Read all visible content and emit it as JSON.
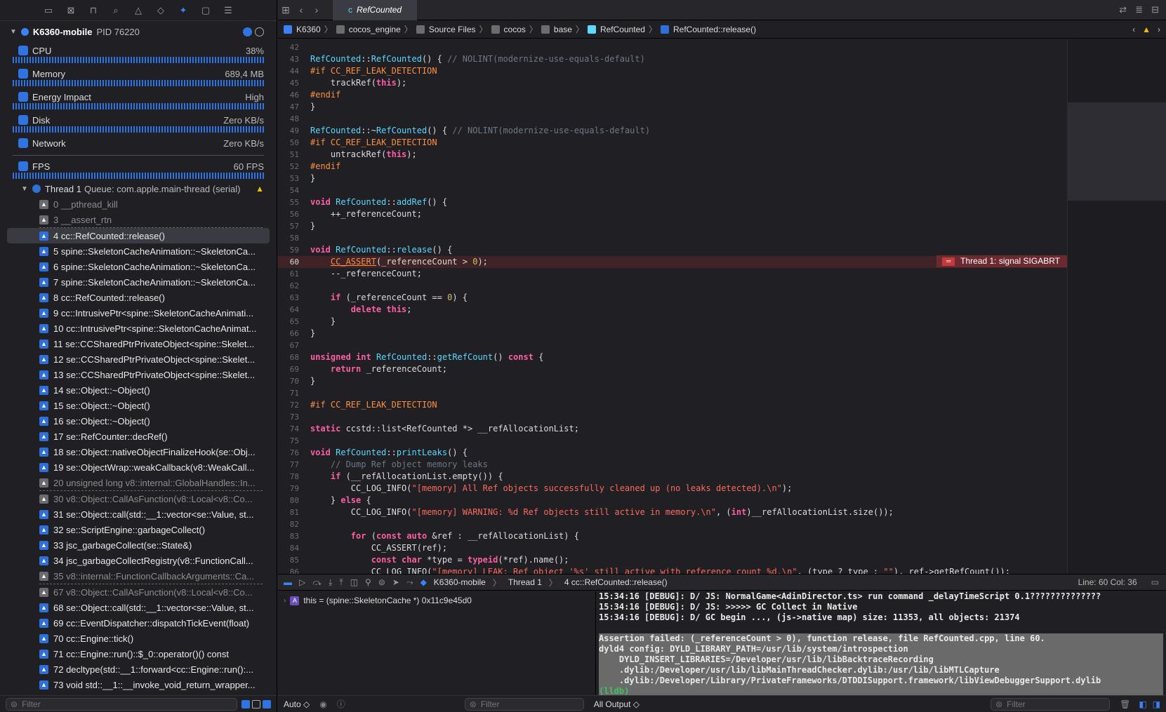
{
  "navigator": {
    "icons": [
      "folder-icon",
      "source-control-icon",
      "hierarchy-icon",
      "search-icon",
      "warning-icon",
      "breakpoint-diamond-icon",
      "debug-spray-icon",
      "tag-icon",
      "report-icon"
    ],
    "process": {
      "name": "K6360-mobile",
      "pid": "PID 76220"
    },
    "gauges": [
      {
        "label": "CPU",
        "value": "38%",
        "color": "#2f74e0",
        "icon": "cpu-icon"
      },
      {
        "label": "Memory",
        "value": "689,4 MB",
        "color": "#2f74e0",
        "icon": "memory-icon"
      },
      {
        "label": "Energy Impact",
        "value": "High",
        "color": "#2f74e0",
        "icon": "energy-icon"
      },
      {
        "label": "Disk",
        "value": "Zero KB/s",
        "color": "#2f74e0",
        "icon": "disk-icon"
      },
      {
        "label": "Network",
        "value": "Zero KB/s",
        "color": "#2f74e0",
        "icon": "network-icon"
      },
      {
        "label": "FPS",
        "value": "60 FPS",
        "color": "#2f74e0",
        "icon": "fps-icon"
      }
    ],
    "thread": {
      "name": "Thread 1",
      "queue": "Queue: com.apple.main-thread (serial)"
    },
    "frames": [
      {
        "text": "0 __pthread_kill",
        "dim": true
      },
      {
        "text": "3 __assert_rtn",
        "dim": true,
        "sepAfter": true
      },
      {
        "text": "4 cc::RefCounted::release()",
        "sel": true
      },
      {
        "text": "5 spine::SkeletonCacheAnimation::~SkeletonCa..."
      },
      {
        "text": "6 spine::SkeletonCacheAnimation::~SkeletonCa..."
      },
      {
        "text": "7 spine::SkeletonCacheAnimation::~SkeletonCa..."
      },
      {
        "text": "8 cc::RefCounted::release()"
      },
      {
        "text": "9 cc::IntrusivePtr<spine::SkeletonCacheAnimati..."
      },
      {
        "text": "10 cc::IntrusivePtr<spine::SkeletonCacheAnimat..."
      },
      {
        "text": "11 se::CCSharedPtrPrivateObject<spine::Skelet..."
      },
      {
        "text": "12 se::CCSharedPtrPrivateObject<spine::Skelet..."
      },
      {
        "text": "13 se::CCSharedPtrPrivateObject<spine::Skelet..."
      },
      {
        "text": "14 se::Object::~Object()"
      },
      {
        "text": "15 se::Object::~Object()"
      },
      {
        "text": "16 se::Object::~Object()"
      },
      {
        "text": "17 se::RefCounter::decRef()"
      },
      {
        "text": "18 se::Object::nativeObjectFinalizeHook(se::Obj..."
      },
      {
        "text": "19 se::ObjectWrap::weakCallback(v8::WeakCall..."
      },
      {
        "text": "20 unsigned long v8::internal::GlobalHandles::In...",
        "dim": true,
        "sepAfter": true
      },
      {
        "text": "30 v8::Object::CallAsFunction(v8::Local<v8::Co...",
        "dim": true
      },
      {
        "text": "31 se::Object::call(std::__1::vector<se::Value, st..."
      },
      {
        "text": "32 se::ScriptEngine::garbageCollect()"
      },
      {
        "text": "33 jsc_garbageCollect(se::State&)"
      },
      {
        "text": "34 jsc_garbageCollectRegistry(v8::FunctionCall..."
      },
      {
        "text": "35 v8::internal::FunctionCallbackArguments::Ca...",
        "dim": true,
        "sepAfter": true
      },
      {
        "text": "67 v8::Object::CallAsFunction(v8::Local<v8::Co...",
        "dim": true
      },
      {
        "text": "68 se::Object::call(std::__1::vector<se::Value, st..."
      },
      {
        "text": "69 cc::EventDispatcher::dispatchTickEvent(float)"
      },
      {
        "text": "70 cc::Engine::tick()"
      },
      {
        "text": "71 cc::Engine::run()::$_0::operator()() const"
      },
      {
        "text": "72 decltype(std::__1::forward<cc::Engine::run():..."
      },
      {
        "text": "73 void std::__1::__invoke_void_return_wrapper..."
      }
    ],
    "filter_placeholder": "Filter"
  },
  "editor": {
    "tab": "RefCounted",
    "breadcrumbs": [
      "K6360",
      "cocos_engine",
      "Source Files",
      "cocos",
      "base",
      "RefCounted",
      "RefCounted::release()"
    ],
    "error_label": "Thread 1: signal SIGABRT",
    "lines": [
      {
        "n": "42",
        "h": ""
      },
      {
        "n": "43",
        "h": "<span class='t'>RefCounted</span>::<span class='t'>RefCounted</span>() { <span class='c'>// NOLINT(modernize-use-equals-default)</span>"
      },
      {
        "n": "44",
        "h": "<span class='p'>#if CC_REF_LEAK_DETECTION</span>"
      },
      {
        "n": "45",
        "h": "    trackRef(<span class='k'>this</span>);"
      },
      {
        "n": "46",
        "h": "<span class='p'>#endif</span>"
      },
      {
        "n": "47",
        "h": "}"
      },
      {
        "n": "48",
        "h": ""
      },
      {
        "n": "49",
        "h": "<span class='t'>RefCounted</span>::~<span class='t'>RefCounted</span>() { <span class='c'>// NOLINT(modernize-use-equals-default)</span>"
      },
      {
        "n": "50",
        "h": "<span class='p'>#if CC_REF_LEAK_DETECTION</span>"
      },
      {
        "n": "51",
        "h": "    untrackRef(<span class='k'>this</span>);"
      },
      {
        "n": "52",
        "h": "<span class='p'>#endif</span>"
      },
      {
        "n": "53",
        "h": "}"
      },
      {
        "n": "54",
        "h": ""
      },
      {
        "n": "55",
        "h": "<span class='k'>void</span> <span class='t'>RefCounted</span>::<span class='t'>addRef</span>() {"
      },
      {
        "n": "56",
        "h": "    ++_referenceCount;"
      },
      {
        "n": "57",
        "h": "}"
      },
      {
        "n": "58",
        "h": ""
      },
      {
        "n": "59",
        "h": "<span class='k'>void</span> <span class='t'>RefCounted</span>::<span class='t'>release</span>() {"
      },
      {
        "n": "60",
        "h": "    <span class='p' style='text-decoration:underline'>CC_ASSERT</span>(_referenceCount > <span class='n'>0</span>);",
        "err": true
      },
      {
        "n": "61",
        "h": "    --_referenceCount;"
      },
      {
        "n": "62",
        "h": ""
      },
      {
        "n": "63",
        "h": "    <span class='k'>if</span> (_referenceCount == <span class='n'>0</span>) {"
      },
      {
        "n": "64",
        "h": "        <span class='k'>delete this</span>;"
      },
      {
        "n": "65",
        "h": "    }"
      },
      {
        "n": "66",
        "h": "}"
      },
      {
        "n": "67",
        "h": ""
      },
      {
        "n": "68",
        "h": "<span class='k'>unsigned int</span> <span class='t'>RefCounted</span>::<span class='t'>getRefCount</span>() <span class='k'>const</span> {"
      },
      {
        "n": "69",
        "h": "    <span class='k'>return</span> _referenceCount;"
      },
      {
        "n": "70",
        "h": "}"
      },
      {
        "n": "71",
        "h": ""
      },
      {
        "n": "72",
        "h": "<span class='p'>#if CC_REF_LEAK_DETECTION</span>"
      },
      {
        "n": "73",
        "h": ""
      },
      {
        "n": "74",
        "h": "<span class='k'>static</span> ccstd::list&lt;RefCounted *&gt; __refAllocationList;"
      },
      {
        "n": "75",
        "h": ""
      },
      {
        "n": "76",
        "h": "<span class='k'>void</span> <span class='t'>RefCounted</span>::<span class='t'>printLeaks</span>() {"
      },
      {
        "n": "77",
        "h": "    <span class='c'>// Dump Ref object memory leaks</span>"
      },
      {
        "n": "78",
        "h": "    <span class='k'>if</span> (__refAllocationList.empty()) {"
      },
      {
        "n": "79",
        "h": "        CC_LOG_INFO(<span class='s'>\"[memory] All Ref objects successfully cleaned up (no leaks detected).\\n\"</span>);"
      },
      {
        "n": "80",
        "h": "    } <span class='k'>else</span> {"
      },
      {
        "n": "81",
        "h": "        CC_LOG_INFO(<span class='s'>\"[memory] WARNING: %d Ref objects still active in memory.\\n\"</span>, (<span class='k'>int</span>)__refAllocationList.size());"
      },
      {
        "n": "82",
        "h": ""
      },
      {
        "n": "83",
        "h": "        <span class='k'>for</span> (<span class='k'>const auto</span> &amp;ref : __refAllocationList) {"
      },
      {
        "n": "84",
        "h": "            CC_ASSERT(ref);"
      },
      {
        "n": "85",
        "h": "            <span class='k'>const char</span> *type = <span class='k'>typeid</span>(*ref).name();"
      },
      {
        "n": "86",
        "h": "            CC_LOG_INFO(<span class='s'>\"[memory] LEAK: Ref object '%s' still active with reference count %d.\\n\"</span>, (type ? type : <span class='s'>\"\"</span>), ref->getRefCount());"
      }
    ]
  },
  "debugbar": {
    "target": "K6360-mobile",
    "thread": "Thread 1",
    "frame": "4 cc::RefCounted::release()",
    "position": "Line: 60  Col: 36"
  },
  "variables": {
    "this": "this = (spine::SkeletonCache *) 0x11c9e45d0"
  },
  "console": {
    "lines": [
      {
        "t": "15:34:16 [DEBUG]: D/ JS: NormalGame<AdinDirector.ts> run command _delayTimeScript 0.1??????????????"
      },
      {
        "t": "15:34:16 [DEBUG]: D/ JS: >>>>> GC Collect in Native"
      },
      {
        "t": "15:34:16 [DEBUG]: D/ GC begin ..., (js->native map) size: 11353, all objects: 21374"
      },
      {
        "t": ""
      },
      {
        "t": "Assertion failed: (_referenceCount > 0), function release, file RefCounted.cpp, line 60.",
        "hl": true
      },
      {
        "t": "dyld4 config: DYLD_LIBRARY_PATH=/usr/lib/system/introspection",
        "hl": true
      },
      {
        "t": "    DYLD_INSERT_LIBRARIES=/Developer/usr/lib/libBacktraceRecording",
        "hl": true
      },
      {
        "t": "    .dylib:/Developer/usr/lib/libMainThreadChecker.dylib:/usr/lib/libMTLCapture",
        "hl": true
      },
      {
        "t": "    .dylib:/Developer/Library/PrivateFrameworks/DTDDISupport.framework/libViewDebuggerSupport.dylib",
        "hl": true
      }
    ],
    "prompt": "(lldb)"
  },
  "bottom": {
    "auto_label": "Auto ◇",
    "filter_placeholder": "Filter",
    "output_label": "All Output ◇",
    "filter2_placeholder": "Filter"
  }
}
